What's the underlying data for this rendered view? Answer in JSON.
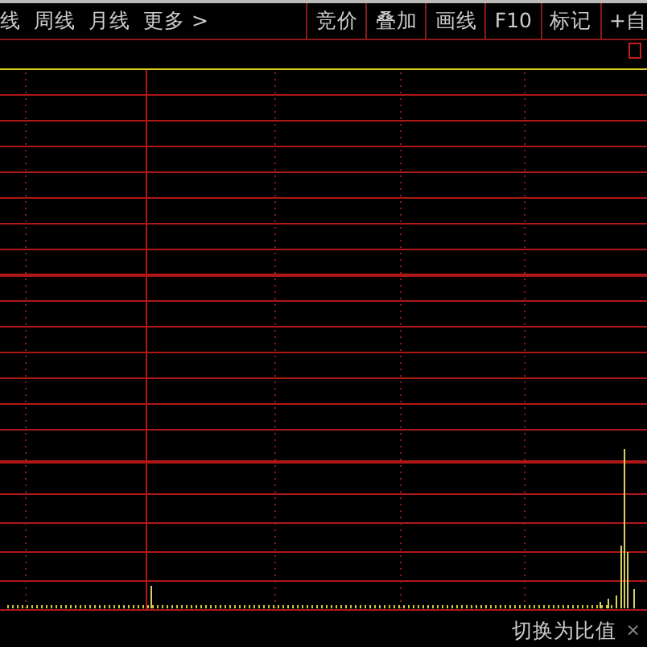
{
  "toolbar": {
    "periods": [
      {
        "label": "线"
      },
      {
        "label": "周线"
      },
      {
        "label": "月线"
      },
      {
        "label": "更多 >"
      }
    ],
    "buttons": [
      {
        "label": "竞价"
      },
      {
        "label": "叠加"
      },
      {
        "label": "画线"
      },
      {
        "label": "F10"
      },
      {
        "label": "标记"
      },
      {
        "label": "+自"
      }
    ]
  },
  "footer": {
    "toggle": "切换为比值",
    "close": "×"
  }
}
